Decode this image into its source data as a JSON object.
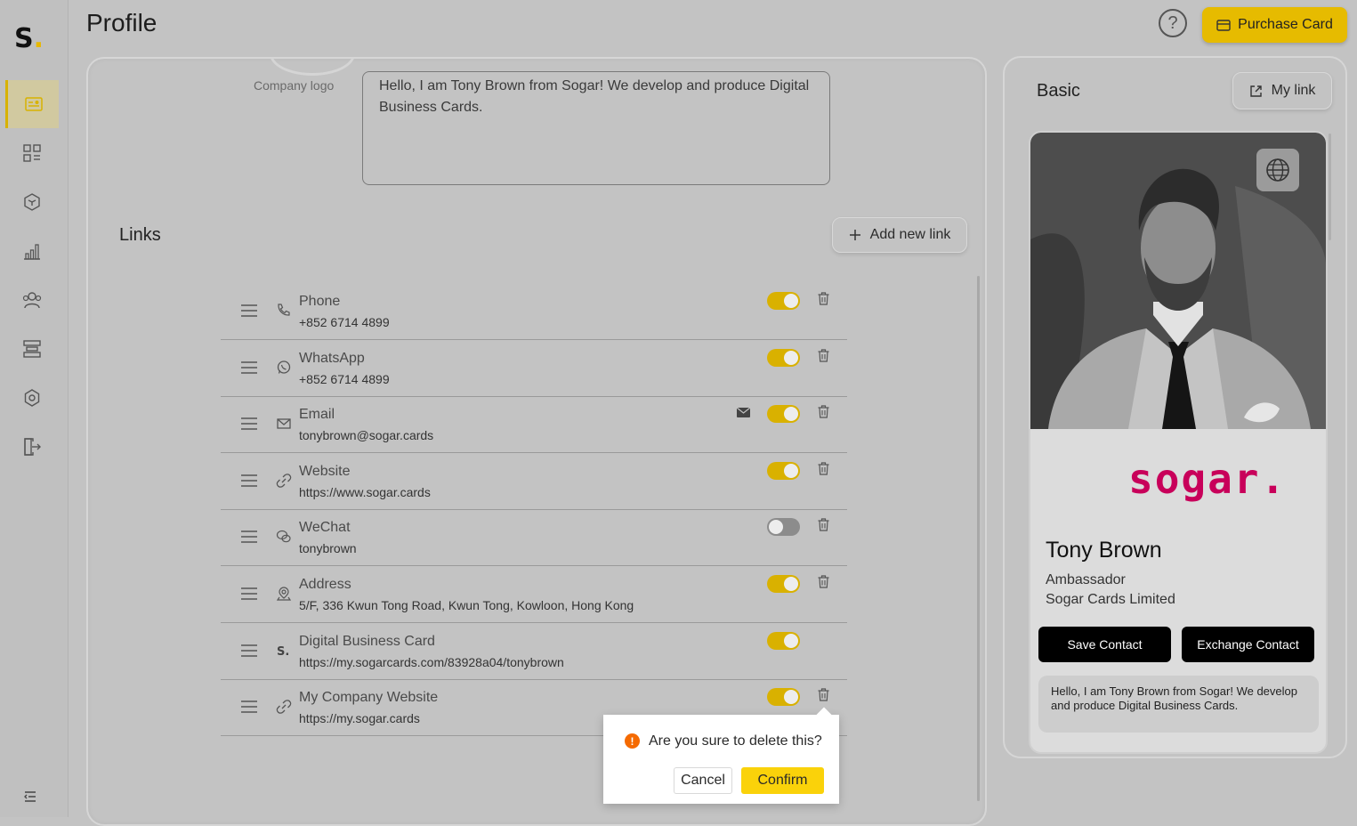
{
  "app": {
    "logo_letter": "S",
    "page_title": "Profile"
  },
  "header": {
    "help_symbol": "?",
    "purchase_label": "Purchase Card",
    "accent_color": "#e6bb00"
  },
  "profile_top": {
    "company_logo_label": "Company logo",
    "bio_text": "Hello, I am Tony Brown from Sogar!  We develop and produce Digital Business Cards."
  },
  "links_section": {
    "title": "Links",
    "add_label": "Add new link"
  },
  "links": [
    {
      "name": "Phone",
      "value": "+852 6714 4899",
      "icon": "phone-icon",
      "enabled": true,
      "deletable": true
    },
    {
      "name": "WhatsApp",
      "value": "+852 6714 4899",
      "icon": "whatsapp-icon",
      "enabled": true,
      "deletable": true
    },
    {
      "name": "Email",
      "value": "tonybrown@sogar.cards",
      "icon": "email-icon",
      "enabled": true,
      "deletable": true
    },
    {
      "name": "Website",
      "value": "https://www.sogar.cards",
      "icon": "link-icon",
      "enabled": true,
      "deletable": true
    },
    {
      "name": "WeChat",
      "value": "tonybrown",
      "icon": "wechat-icon",
      "enabled": false,
      "deletable": true
    },
    {
      "name": "Address",
      "value": "5/F, 336 Kwun Tong Road, Kwun Tong, Kowloon, Hong Kong",
      "icon": "location-icon",
      "enabled": true,
      "deletable": true
    },
    {
      "name": "Digital Business Card",
      "value": "https://my.sogarcards.com/83928a04/tonybrown",
      "icon": "sogar-icon",
      "enabled": true,
      "deletable": false
    },
    {
      "name": "My Company Website",
      "value": "https://my.sogar.cards",
      "icon": "link-icon",
      "enabled": true,
      "deletable": true
    }
  ],
  "delete_popover": {
    "icon_symbol": "!",
    "message": "Are you sure to delete this?",
    "cancel_label": "Cancel",
    "confirm_label": "Confirm"
  },
  "preview": {
    "panel_title": "Basic",
    "my_link_label": "My link",
    "brand_text": "sogar.",
    "brand_color": "#c8005a",
    "name": "Tony Brown",
    "role": "Ambassador",
    "company": "Sogar Cards Limited",
    "save_label": "Save Contact",
    "exchange_label": "Exchange Contact",
    "bio": "Hello, I am Tony Brown from Sogar! We develop and produce Digital Business Cards."
  }
}
